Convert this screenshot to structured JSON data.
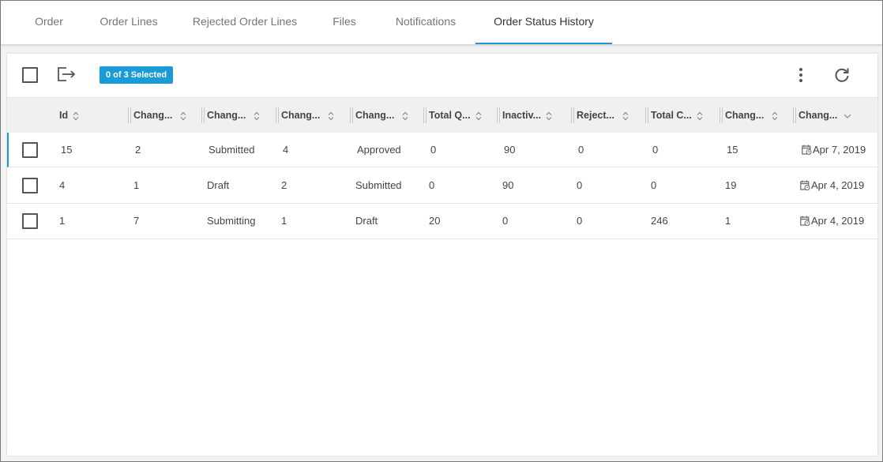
{
  "tabs": [
    {
      "label": "Order",
      "active": false
    },
    {
      "label": "Order Lines",
      "active": false
    },
    {
      "label": "Rejected Order Lines",
      "active": false
    },
    {
      "label": "Files",
      "active": false
    },
    {
      "label": "Notifications",
      "active": false
    },
    {
      "label": "Order Status History",
      "active": true
    }
  ],
  "toolbar": {
    "selection_badge": "0 of 3 Selected",
    "icons": [
      "export-icon",
      "more-vert-icon",
      "refresh-icon"
    ]
  },
  "grid": {
    "columns": [
      {
        "label": "Id",
        "sort": "sortable"
      },
      {
        "label": "Chang...",
        "sort": "sortable"
      },
      {
        "label": "Chang...",
        "sort": "sortable"
      },
      {
        "label": "Chang...",
        "sort": "sortable"
      },
      {
        "label": "Chang...",
        "sort": "sortable"
      },
      {
        "label": "Total Q...",
        "sort": "sortable"
      },
      {
        "label": "Inactiv...",
        "sort": "sortable"
      },
      {
        "label": "Reject...",
        "sort": "sortable"
      },
      {
        "label": "Total C...",
        "sort": "sortable"
      },
      {
        "label": "Chang...",
        "sort": "sortable"
      },
      {
        "label": "Chang...",
        "sort": "descending"
      }
    ],
    "rows": [
      {
        "cells": [
          "15",
          "2",
          "Submitted",
          "4",
          "Approved",
          "0",
          "90",
          "0",
          "0",
          "15",
          "Apr 7, 2019"
        ]
      },
      {
        "cells": [
          "4",
          "1",
          "Draft",
          "2",
          "Submitted",
          "0",
          "90",
          "0",
          "0",
          "19",
          "Apr 4, 2019"
        ]
      },
      {
        "cells": [
          "1",
          "7",
          "Submitting",
          "1",
          "Draft",
          "20",
          "0",
          "0",
          "246",
          "1",
          "Apr 4, 2019"
        ]
      }
    ]
  },
  "colors": {
    "accent": "#1a9bd7",
    "header_bg": "#f0f0f0",
    "page_bg": "#f2f2f2"
  }
}
